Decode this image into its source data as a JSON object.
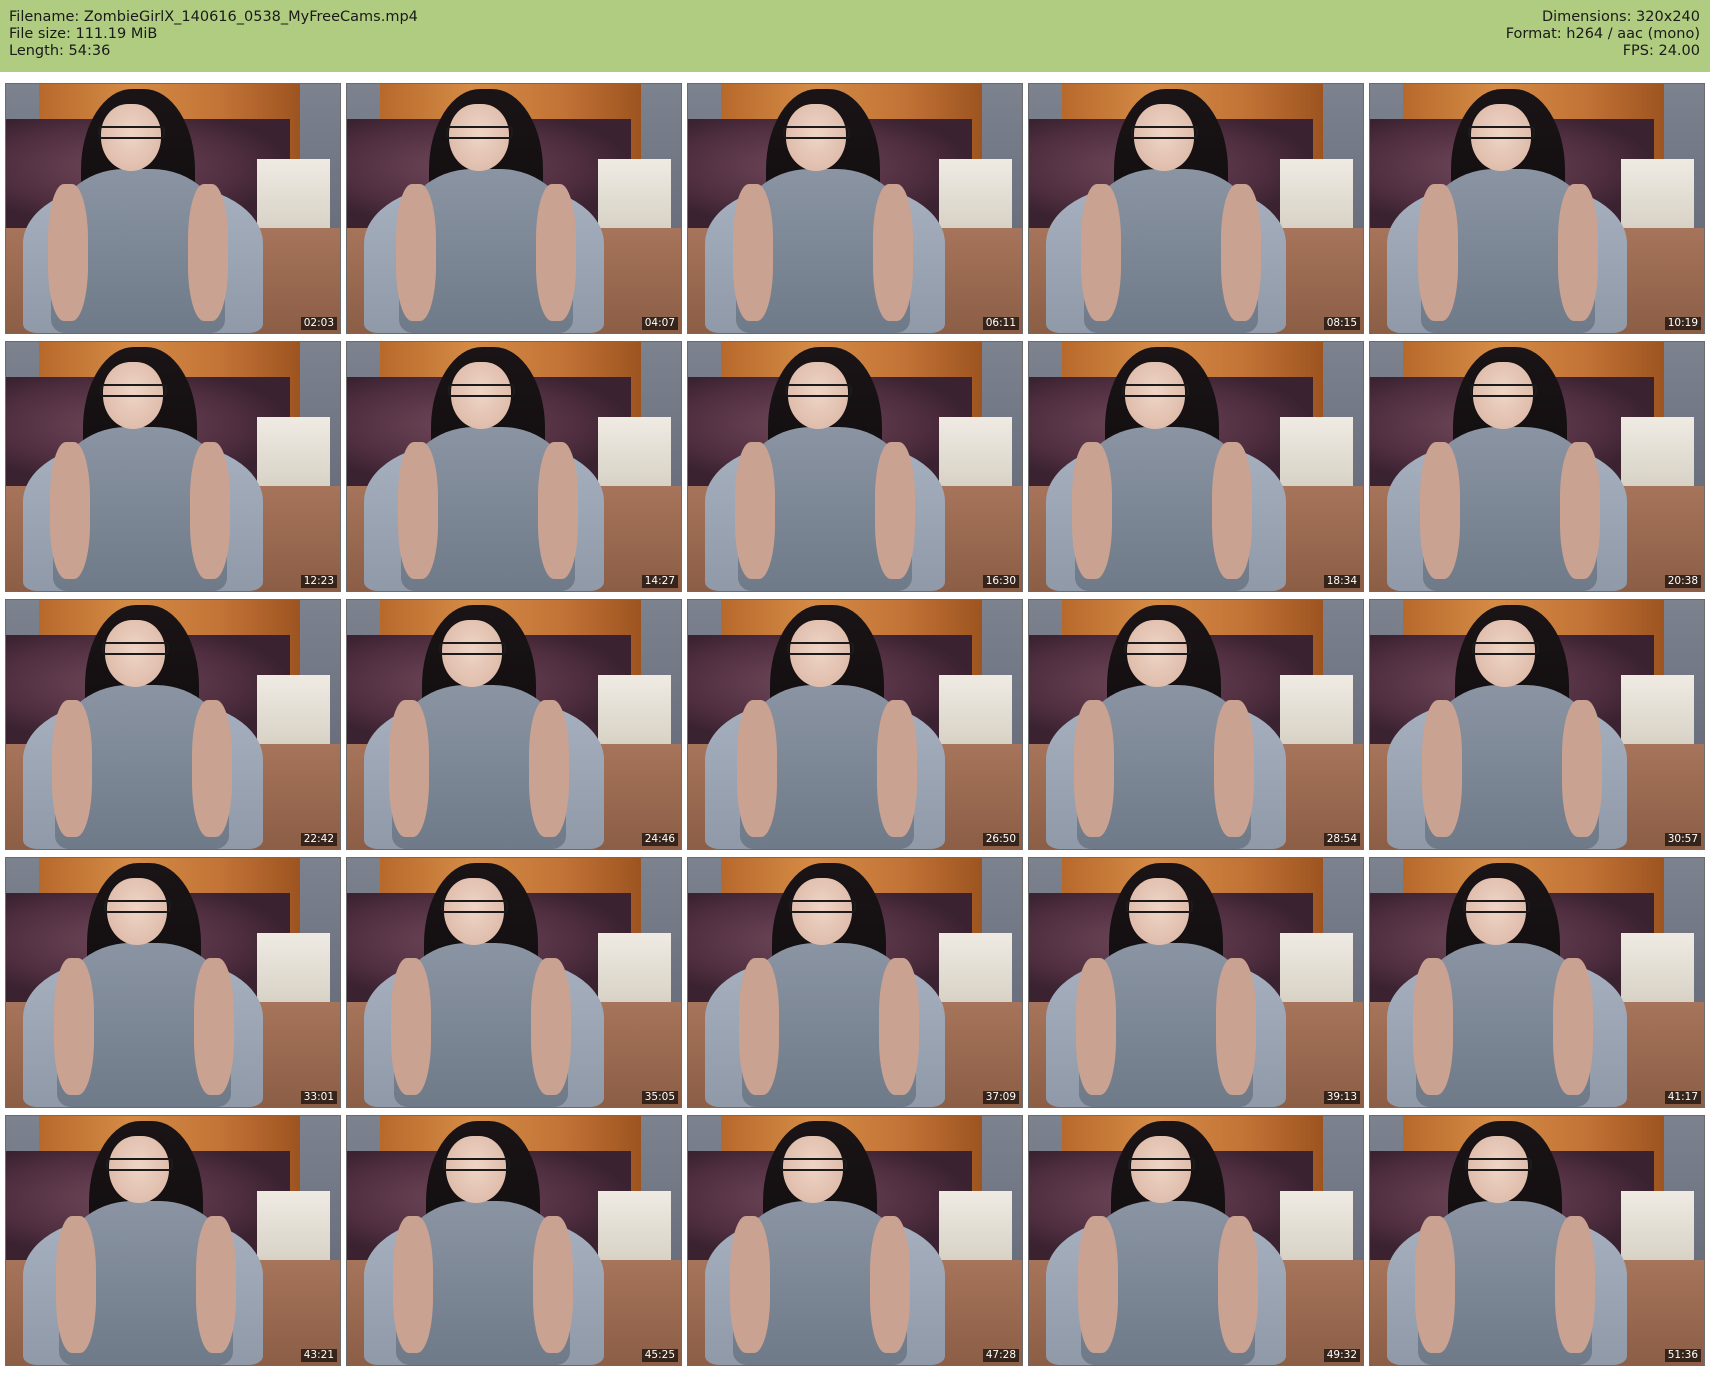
{
  "header": {
    "filename": "Filename: ZombieGirlX_140616_0538_MyFreeCams.mp4",
    "filesize": "File size: 111.19 MiB",
    "length": "Length: 54:36",
    "dimensions": "Dimensions: 320x240",
    "format": "Format: h264 / aac (mono)",
    "fps": "FPS: 24.00"
  },
  "colors": {
    "header_bg": "#b0cc80",
    "page_bg": "#ffffff"
  },
  "thumbnails": [
    {
      "timestamp": "02:03"
    },
    {
      "timestamp": "04:07"
    },
    {
      "timestamp": "06:11"
    },
    {
      "timestamp": "08:15"
    },
    {
      "timestamp": "10:19"
    },
    {
      "timestamp": "12:23"
    },
    {
      "timestamp": "14:27"
    },
    {
      "timestamp": "16:30"
    },
    {
      "timestamp": "18:34"
    },
    {
      "timestamp": "20:38"
    },
    {
      "timestamp": "22:42"
    },
    {
      "timestamp": "24:46"
    },
    {
      "timestamp": "26:50"
    },
    {
      "timestamp": "28:54"
    },
    {
      "timestamp": "30:57"
    },
    {
      "timestamp": "33:01"
    },
    {
      "timestamp": "35:05"
    },
    {
      "timestamp": "37:09"
    },
    {
      "timestamp": "39:13"
    },
    {
      "timestamp": "41:17"
    },
    {
      "timestamp": "43:21"
    },
    {
      "timestamp": "45:25"
    },
    {
      "timestamp": "47:28"
    },
    {
      "timestamp": "49:32"
    },
    {
      "timestamp": "51:36"
    }
  ]
}
